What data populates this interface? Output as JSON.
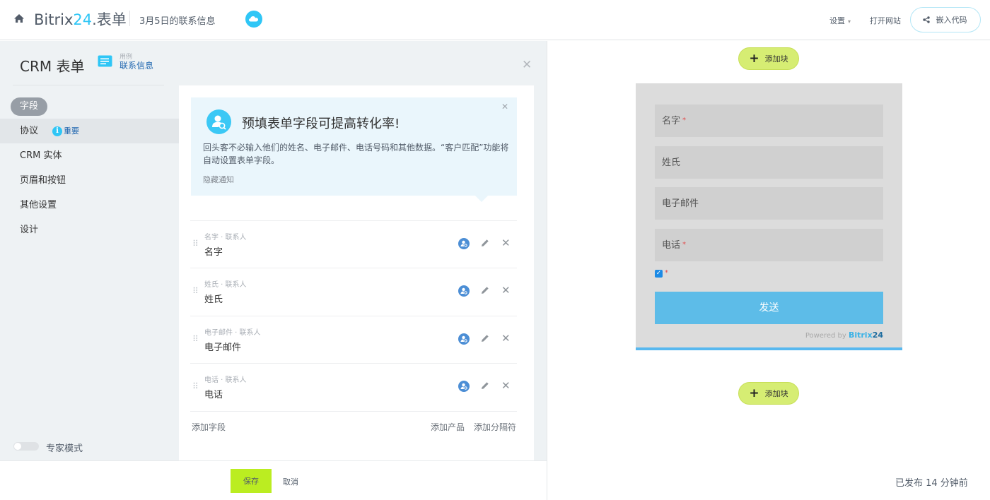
{
  "topbar": {
    "brand_main": "Bitrix",
    "brand_num": "24",
    "brand_suffix": ".表单",
    "subtitle": "3月5日的联系信息",
    "settings": "设置",
    "open_site": "打开网站",
    "embed_code": "嵌入代码"
  },
  "panel": {
    "title": "CRM 表单",
    "example_caption": "用例",
    "example_link": "联系信息"
  },
  "nav": {
    "fields": "字段",
    "agreement": "协议",
    "important": "重要",
    "crm_entity": "CRM 实体",
    "header_buttons": "页眉和按钮",
    "other_settings": "其他设置",
    "design": "设计"
  },
  "promo": {
    "title": "预填表单字段可提高转化率!",
    "text": "回头客不必输入他们的姓名、电子邮件、电话号码和其他数据。“客户匹配”功能将自动设置表单字段。",
    "hide": "隐藏通知"
  },
  "fields": [
    {
      "caption": "名字 · 联系人",
      "name": "名字"
    },
    {
      "caption": "姓氏 · 联系人",
      "name": "姓氏"
    },
    {
      "caption": "电子邮件 · 联系人",
      "name": "电子邮件"
    },
    {
      "caption": "电话 · 联系人",
      "name": "电话"
    }
  ],
  "actions": {
    "add_field": "添加字段",
    "add_product": "添加产品",
    "add_divider": "添加分隔符"
  },
  "expert_mode": "专家模式",
  "bottom": {
    "save": "保存",
    "cancel": "取消"
  },
  "preview": {
    "add_block": "添加块",
    "inputs": [
      {
        "label": "名字",
        "required": "*"
      },
      {
        "label": "姓氏",
        "required": ""
      },
      {
        "label": "电子邮件",
        "required": ""
      },
      {
        "label": "电话",
        "required": "*"
      }
    ],
    "checkbox_checked": true,
    "checkbox_required": "*",
    "submit": "发送",
    "powered_by": "Powered by",
    "powered_brand": "Bitrix",
    "powered_num": "24",
    "published": "已发布 14 分钟前"
  },
  "colors": {
    "accent": "#2fc6f6",
    "save_green": "#bbed21",
    "add_block_green": "#d6ed73",
    "submit_blue": "#5dbce8"
  }
}
